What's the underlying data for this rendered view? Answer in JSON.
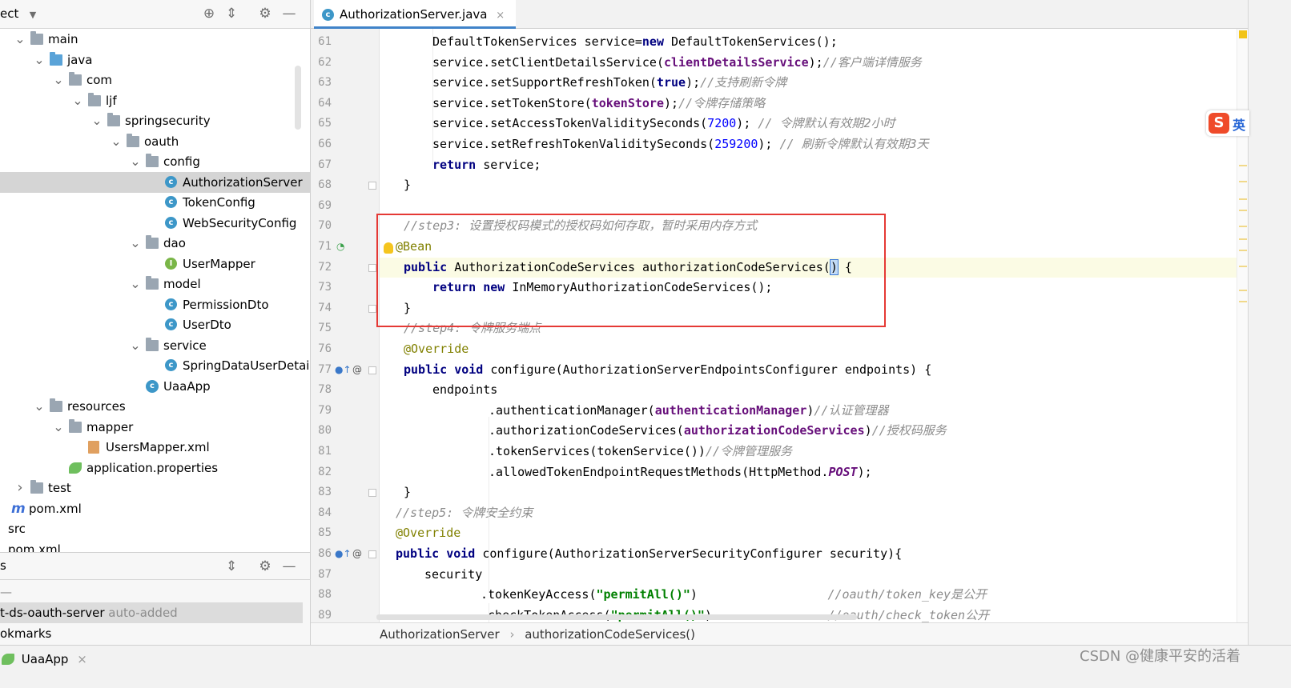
{
  "project_panel": {
    "title": "ect",
    "tree": [
      {
        "label": "main",
        "icon": "folder-icon",
        "twisty": "open"
      },
      {
        "label": "java",
        "icon": "source-folder-icon",
        "twisty": "open"
      },
      {
        "label": "com",
        "icon": "package-icon",
        "twisty": "open"
      },
      {
        "label": "ljf",
        "icon": "package-icon",
        "twisty": "open"
      },
      {
        "label": "springsecurity",
        "icon": "package-icon",
        "twisty": "open"
      },
      {
        "label": "oauth",
        "icon": "package-icon",
        "twisty": "open"
      },
      {
        "label": "config",
        "icon": "package-icon",
        "twisty": "open"
      },
      {
        "label": "AuthorizationServer",
        "icon": "class-icon",
        "selected": true
      },
      {
        "label": "TokenConfig",
        "icon": "class-icon"
      },
      {
        "label": "WebSecurityConfig",
        "icon": "class-icon"
      },
      {
        "label": "dao",
        "icon": "package-icon",
        "twisty": "open"
      },
      {
        "label": "UserMapper",
        "icon": "interface-icon"
      },
      {
        "label": "model",
        "icon": "package-icon",
        "twisty": "open"
      },
      {
        "label": "PermissionDto",
        "icon": "class-icon"
      },
      {
        "label": "UserDto",
        "icon": "class-icon"
      },
      {
        "label": "service",
        "icon": "package-icon",
        "twisty": "open"
      },
      {
        "label": "SpringDataUserDetai",
        "icon": "class-icon"
      },
      {
        "label": "UaaApp",
        "icon": "spring-app-icon"
      },
      {
        "label": "resources",
        "icon": "resources-folder-icon",
        "twisty": "open"
      },
      {
        "label": "mapper",
        "icon": "package-icon",
        "twisty": "open"
      },
      {
        "label": "UsersMapper.xml",
        "icon": "xml-file-icon"
      },
      {
        "label": "application.properties",
        "icon": "properties-file-icon"
      },
      {
        "label": "test",
        "icon": "folder-icon",
        "twisty": "closed"
      },
      {
        "label": "pom.xml",
        "icon": "maven-icon"
      },
      {
        "label": "src",
        "icon": "none"
      },
      {
        "label": "pom.xml",
        "icon": "none"
      }
    ]
  },
  "services_panel": {
    "title": "s",
    "dash": "—",
    "rows": [
      {
        "label": "t-ds-oauth-server",
        "suffix": "auto-added",
        "selected": true
      },
      {
        "label": "okmarks",
        "suffix": ""
      }
    ]
  },
  "editor": {
    "tab_label": "AuthorizationServer.java",
    "tab_close": "×",
    "lines": [
      {
        "n": "61",
        "segs": [
          [
            "i2",
            ""
          ],
          [
            "t",
            "DefaultTokenServices service="
          ],
          [
            "kw",
            "new"
          ],
          [
            "t",
            " DefaultTokenServices();"
          ]
        ]
      },
      {
        "n": "62",
        "segs": [
          [
            "i2",
            ""
          ],
          [
            "t",
            "service.setClientDetailsService("
          ],
          [
            "fld",
            "clientDetailsService"
          ],
          [
            "t",
            ");"
          ],
          [
            "cmt",
            "//客户端详情服务"
          ]
        ]
      },
      {
        "n": "63",
        "segs": [
          [
            "i2",
            ""
          ],
          [
            "t",
            "service.setSupportRefreshToken("
          ],
          [
            "kw",
            "true"
          ],
          [
            "t",
            ");"
          ],
          [
            "cmt",
            "//支持刷新令牌"
          ]
        ]
      },
      {
        "n": "64",
        "segs": [
          [
            "i2",
            ""
          ],
          [
            "t",
            "service.setTokenStore("
          ],
          [
            "fld",
            "tokenStore"
          ],
          [
            "t",
            ");"
          ],
          [
            "cmt",
            "//令牌存储策略"
          ]
        ]
      },
      {
        "n": "65",
        "segs": [
          [
            "i2",
            ""
          ],
          [
            "t",
            "service.setAccessTokenValiditySeconds("
          ],
          [
            "num",
            "7200"
          ],
          [
            "t",
            "); "
          ],
          [
            "cmt",
            "// 令牌默认有效期2小时"
          ]
        ]
      },
      {
        "n": "66",
        "segs": [
          [
            "i2",
            ""
          ],
          [
            "t",
            "service.setRefreshTokenValiditySeconds("
          ],
          [
            "num",
            "259200"
          ],
          [
            "t",
            "); "
          ],
          [
            "cmt",
            "// 刷新令牌默认有效期3天"
          ]
        ]
      },
      {
        "n": "67",
        "segs": [
          [
            "i2",
            ""
          ],
          [
            "kw",
            "return"
          ],
          [
            "t",
            " service;"
          ]
        ]
      },
      {
        "n": "68",
        "segs": [
          [
            "i1",
            ""
          ],
          [
            "t",
            "}"
          ]
        ]
      },
      {
        "n": "69",
        "segs": []
      },
      {
        "n": "70",
        "segs": [
          [
            "i1",
            ""
          ],
          [
            "cmt",
            "//step3: 设置授权码模式的授权码如何存取，暂时采用内存方式"
          ]
        ]
      },
      {
        "n": "71",
        "segs": [
          [
            "i0",
            ""
          ],
          [
            "ann",
            "@Bean"
          ]
        ]
      },
      {
        "n": "72",
        "current": true,
        "segs": [
          [
            "i1",
            ""
          ],
          [
            "kw",
            "public"
          ],
          [
            "t",
            " AuthorizationCodeServices authorizationCodeServices("
          ],
          [
            "caret",
            ")"
          ],
          [
            "t",
            " {"
          ]
        ]
      },
      {
        "n": "73",
        "segs": [
          [
            "i2",
            ""
          ],
          [
            "kw",
            "return new"
          ],
          [
            "t",
            " InMemoryAuthorizationCodeServices();"
          ]
        ]
      },
      {
        "n": "74",
        "segs": [
          [
            "i1",
            ""
          ],
          [
            "t",
            "}"
          ]
        ]
      },
      {
        "n": "75",
        "segs": [
          [
            "i1",
            ""
          ],
          [
            "cmt",
            "//step4: 令牌服务端点"
          ]
        ]
      },
      {
        "n": "76",
        "segs": [
          [
            "i1",
            ""
          ],
          [
            "ann",
            "@Override"
          ]
        ]
      },
      {
        "n": "77",
        "segs": [
          [
            "i1",
            ""
          ],
          [
            "kw",
            "public void"
          ],
          [
            "t",
            " configure(AuthorizationServerEndpointsConfigurer endpoints) {"
          ]
        ]
      },
      {
        "n": "78",
        "segs": [
          [
            "i2",
            ""
          ],
          [
            "t",
            "endpoints"
          ]
        ]
      },
      {
        "n": "79",
        "segs": [
          [
            "i4",
            ""
          ],
          [
            "t",
            ".authenticationManager("
          ],
          [
            "fld",
            "authenticationManager"
          ],
          [
            "t",
            ")"
          ],
          [
            "cmt",
            "//认证管理器"
          ]
        ]
      },
      {
        "n": "80",
        "segs": [
          [
            "i4",
            ""
          ],
          [
            "t",
            ".authorizationCodeServices("
          ],
          [
            "fld",
            "authorizationCodeServices"
          ],
          [
            "t",
            ")"
          ],
          [
            "cmt",
            "//授权码服务"
          ]
        ]
      },
      {
        "n": "81",
        "segs": [
          [
            "i4",
            ""
          ],
          [
            "t",
            ".tokenServices(tokenService())"
          ],
          [
            "cmt",
            "//令牌管理服务"
          ]
        ]
      },
      {
        "n": "82",
        "segs": [
          [
            "i4",
            ""
          ],
          [
            "t",
            ".allowedTokenEndpointRequestMethods(HttpMethod."
          ],
          [
            "stat",
            "POST"
          ],
          [
            "t",
            ");"
          ]
        ]
      },
      {
        "n": "83",
        "segs": [
          [
            "i1",
            ""
          ],
          [
            "t",
            "}"
          ]
        ]
      },
      {
        "n": "84",
        "segs": [
          [
            "i0",
            ""
          ],
          [
            "cmt",
            "//step5: 令牌安全约束"
          ]
        ]
      },
      {
        "n": "85",
        "segs": [
          [
            "i0",
            ""
          ],
          [
            "ann",
            "@Override"
          ]
        ]
      },
      {
        "n": "86",
        "segs": [
          [
            "i0",
            ""
          ],
          [
            "kw",
            "public void"
          ],
          [
            "t",
            " configure(AuthorizationServerSecurityConfigurer security){"
          ]
        ]
      },
      {
        "n": "87",
        "segs": [
          [
            "i1b",
            ""
          ],
          [
            "t",
            "security"
          ]
        ]
      },
      {
        "n": "88",
        "segs": [
          [
            "i3",
            ""
          ],
          [
            "t",
            ".tokenKeyAccess("
          ],
          [
            "str",
            "\"permitAll()\""
          ],
          [
            "t",
            ")                  "
          ],
          [
            "cmt",
            "//oauth/token_key是公开"
          ]
        ]
      },
      {
        "n": "89",
        "segs": [
          [
            "i3",
            ""
          ],
          [
            "t",
            ".checkTokenAccess("
          ],
          [
            "str",
            "\"permitAll()\""
          ],
          [
            "t",
            ")                "
          ],
          [
            "cmt",
            "//oauth/check_token公开"
          ]
        ]
      }
    ],
    "breadcrumb": [
      "AuthorizationServer",
      "authorizationCodeServices()"
    ],
    "breadcrumb_sep": "›"
  },
  "ime_badge": {
    "glyph": "S",
    "text": "英"
  },
  "bottom_bar": {
    "run_tab": "UaaApp",
    "run_close": "×",
    "watermark": "CSDN @健康平安的活着"
  },
  "colors": {
    "accent": "#4083c9",
    "highlight_box": "#e53935",
    "keyword": "#000080",
    "field": "#660e7a",
    "string": "#008000",
    "comment": "#8c8c8c",
    "annotation": "#808000",
    "number": "#0000ff"
  }
}
